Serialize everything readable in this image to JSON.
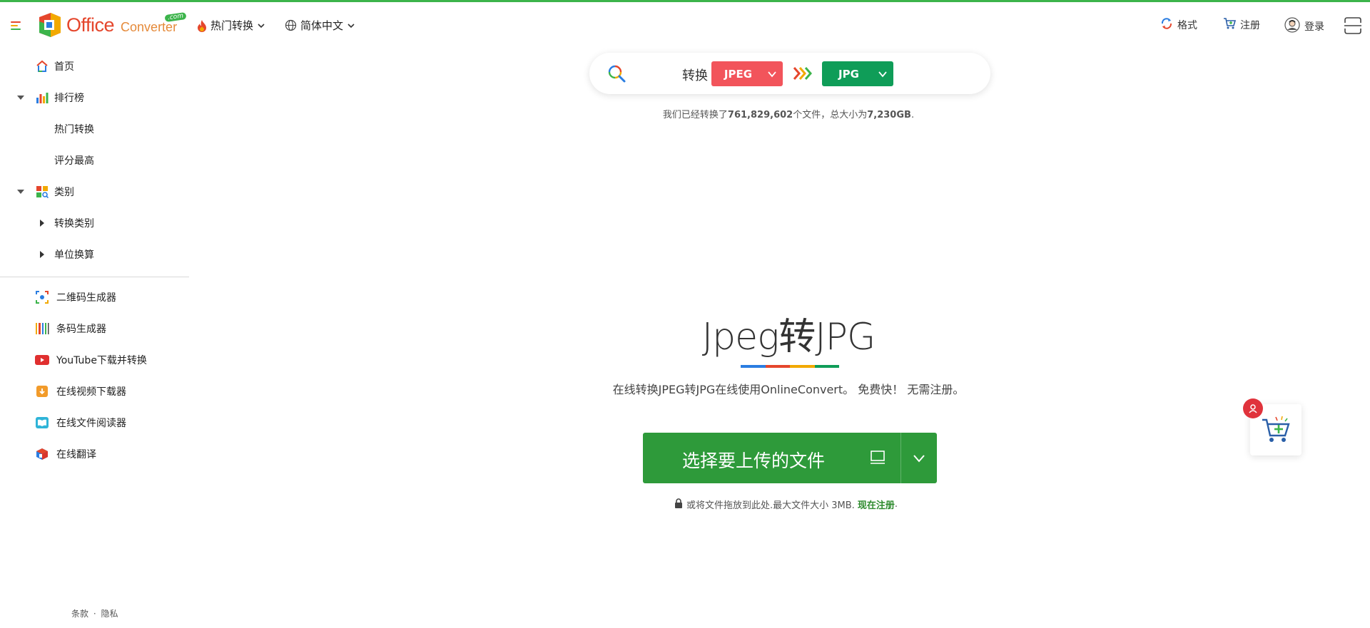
{
  "header": {
    "logo_word": "Office",
    "logo_converter": "Converter",
    "logo_com": ".com",
    "hot_convert": "热门转换",
    "language": "简体中文",
    "formats": "格式",
    "register": "注册",
    "login": "登录"
  },
  "sidebar": {
    "home": "首页",
    "rankings": "排行榜",
    "hot_conversions": "热门转换",
    "top_rated": "评分最高",
    "categories": "类别",
    "convert_categories": "转换类别",
    "unit_conversion": "单位换算",
    "tools": [
      {
        "label": "二维码生成器",
        "icon": "qr-code-icon"
      },
      {
        "label": "条码生成器",
        "icon": "barcode-icon"
      },
      {
        "label": "YouTube下载并转换",
        "icon": "youtube-icon"
      },
      {
        "label": "在线视频下载器",
        "icon": "video-download-icon"
      },
      {
        "label": "在线文件阅读器",
        "icon": "file-reader-icon"
      },
      {
        "label": "在线翻译",
        "icon": "translate-icon"
      }
    ],
    "footer_terms": "条款",
    "footer_sep": "·",
    "footer_privacy": "隐私"
  },
  "search": {
    "convert_label": "转换",
    "from_format": "JPEG",
    "to_format": "JPG"
  },
  "stats": {
    "prefix": "我们已经转换了",
    "files_count": "761,829,602",
    "middle": "个文件，总大小为",
    "total_size": "7,230GB",
    "suffix": "."
  },
  "main": {
    "title": "Jpeg转JPG",
    "subtitle": "在线转换JPEG转JPG在线使用OnlineConvert。 免费快！ 无需注册。",
    "upload_label": "选择要上传的文件",
    "drop_note": "或将文件拖放到此处.最大文件大小 3MB.",
    "register_now": "现在注册",
    "drop_note_end": "."
  },
  "colors": {
    "accent_green": "#2e9a3a",
    "from_format_bg": "#f2545b",
    "to_format_bg": "#0f9d58",
    "top_line": "#3cb44b"
  }
}
